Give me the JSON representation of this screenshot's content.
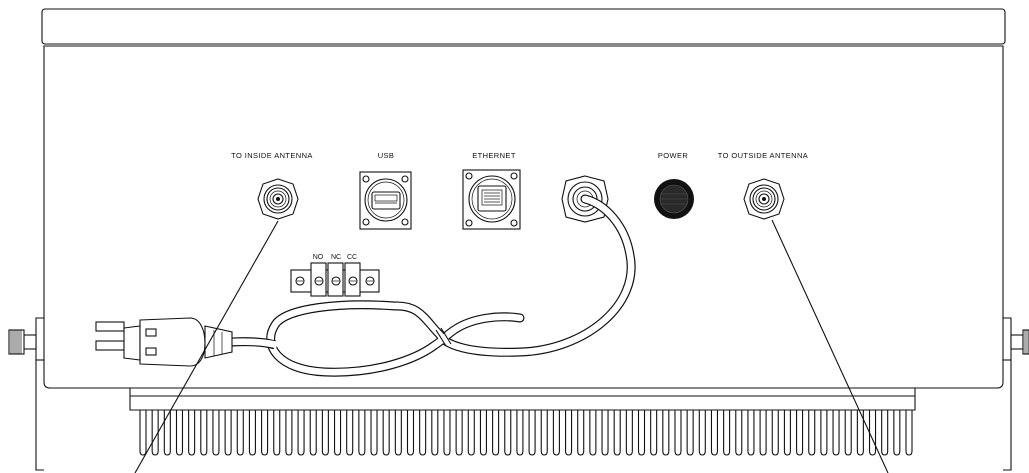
{
  "labels": {
    "inside_antenna": "TO INSIDE ANTENNA",
    "usb": "USB",
    "ethernet": "ETHERNET",
    "power": "POWER",
    "outside_antenna": "TO OUTSIDE ANTENNA"
  },
  "terminals": [
    "NO",
    "NC",
    "CC"
  ],
  "heatsink_fin_count": 64
}
